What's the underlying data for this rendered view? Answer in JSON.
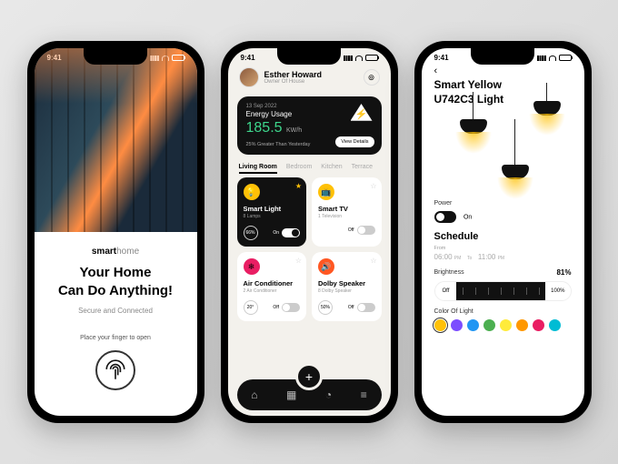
{
  "status": {
    "time": "9:41"
  },
  "onboarding": {
    "brand1": "smart",
    "brand2": "home",
    "headline_l1": "Your Home",
    "headline_l2": "Can Do Anything!",
    "subtitle": "Secure and Connected",
    "hint": "Place your finger to open"
  },
  "home": {
    "user": {
      "name": "Esther Howard",
      "role": "Owner Of House"
    },
    "energy": {
      "date": "13 Sep 2022",
      "title": "Energy Usage",
      "value": "185.5",
      "unit": "KW/h",
      "comparison": "25% Greater Than Yesterday",
      "details_btn": "View Details"
    },
    "tabs": [
      "Living Room",
      "Bedroom",
      "Kitchen",
      "Terrace"
    ],
    "devices": [
      {
        "name": "Smart Light",
        "sub": "8 Lamps",
        "value": "66%",
        "state": "On",
        "on": true,
        "featured": true,
        "icon": "💡",
        "iconbg": "#ffc107"
      },
      {
        "name": "Smart TV",
        "sub": "1 Television",
        "value": "",
        "state": "Off",
        "on": false,
        "featured": false,
        "icon": "📺",
        "iconbg": "#ffc107"
      },
      {
        "name": "Air Conditioner",
        "sub": "2 Air Conditioner",
        "value": "20°",
        "state": "Off",
        "on": false,
        "featured": false,
        "icon": "❄",
        "iconbg": "#e91e63"
      },
      {
        "name": "Dolby Speaker",
        "sub": "8 Dolby Speaker",
        "value": "50%",
        "state": "Off",
        "on": false,
        "featured": false,
        "icon": "🔊",
        "iconbg": "#ff5722"
      }
    ]
  },
  "detail": {
    "title_l1": "Smart Yellow",
    "title_l2": "U742C3 Light",
    "power_label": "Power",
    "power_state": "On",
    "schedule_title": "Schedule",
    "schedule_from_label": "From",
    "time_from": "06:00",
    "time_from_suffix": "PM",
    "time_to_label": "To",
    "time_to": "11:00",
    "time_to_suffix": "PM",
    "brightness_label": "Brightness",
    "brightness_value": "81%",
    "slider_off": "Off",
    "slider_max": "100%",
    "color_label": "Color Of Light",
    "colors": [
      "#ffc107",
      "#7c4dff",
      "#2196f3",
      "#4caf50",
      "#ffeb3b",
      "#ff9800",
      "#e91e63",
      "#00bcd4"
    ]
  }
}
